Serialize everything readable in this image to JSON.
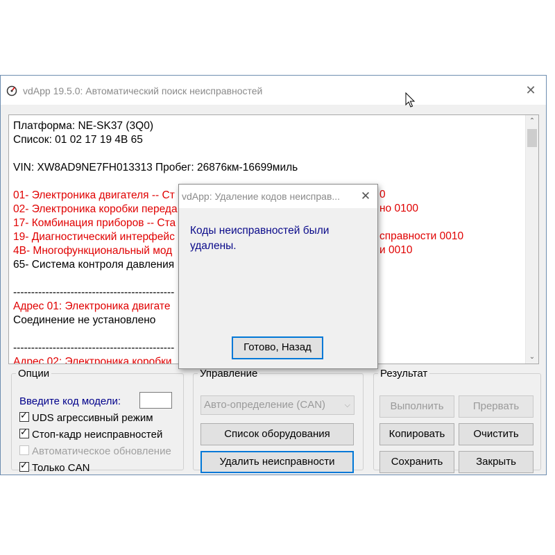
{
  "window": {
    "title": "vdApp 19.5.0:  Автоматический поиск неисправностей",
    "close_glyph": "✕",
    "icon": "vdapp-logo-icon"
  },
  "log": {
    "lines": [
      {
        "text": "Платформа: NE-SK37 (3Q0)",
        "color": "#000000"
      },
      {
        "text": "Список: 01 02 17 19 4B 65",
        "color": "#000000"
      },
      {
        "text": "",
        "color": "#000000"
      },
      {
        "text": "VIN: XW8AD9NE7FH013313   Пробег: 26876км-16699миль",
        "color": "#000000"
      },
      {
        "text": "",
        "color": "#000000"
      },
      {
        "text": "01- Электроника двигателя -- Ст",
        "color": "#e00000"
      },
      {
        "text": "02- Электроника коробки переда",
        "color": "#e00000"
      },
      {
        "text": "17- Комбинация приборов -- Ста",
        "color": "#e00000"
      },
      {
        "text": "19- Диагностический интерфейс",
        "color": "#e00000"
      },
      {
        "text": "4B- Многофункциональный мод",
        "color": "#e00000"
      },
      {
        "text": "65- Система контроля давления",
        "color": "#000000"
      },
      {
        "text": "",
        "color": "#000000"
      },
      {
        "text": "---------------------------------------------",
        "color": "#000000"
      },
      {
        "text": "Адрес 01:  Электроника двигате",
        "color": "#e00000"
      },
      {
        "text": "Соединение не установлено",
        "color": "#000000"
      },
      {
        "text": "",
        "color": "#000000"
      },
      {
        "text": "---------------------------------------------",
        "color": "#000000"
      },
      {
        "text": "Адрес 02:  Электроника коробки",
        "color": "#e00000"
      }
    ],
    "visible_right_fragments": [
      {
        "line": 5,
        "text": "0"
      },
      {
        "line": 6,
        "text": "но 0100"
      },
      {
        "line": 8,
        "text": "справности 0010"
      },
      {
        "line": 9,
        "text": "и 0010"
      }
    ]
  },
  "options": {
    "legend": "Опции",
    "model_label": "Введите код модели:",
    "model_value": "",
    "checkboxes": [
      {
        "label": "UDS агрессивный режим",
        "checked": true,
        "disabled": false
      },
      {
        "label": "Стоп-кадр неисправностей",
        "checked": true,
        "disabled": false
      },
      {
        "label": "Автоматическое обновление",
        "checked": false,
        "disabled": true
      },
      {
        "label": "Только CAN",
        "checked": true,
        "disabled": false
      }
    ]
  },
  "control": {
    "legend": "Управление",
    "dropdown_value": "Авто-определение (CAN)",
    "equipment_button": "Список оборудования",
    "delete_faults_button": "Удалить неисправности"
  },
  "result": {
    "legend": "Результат",
    "execute_button": "Выполнить",
    "abort_button": "Прервать",
    "copy_button": "Копировать",
    "clear_button": "Очистить",
    "save_button": "Сохранить",
    "close_button": "Закрыть"
  },
  "dialog": {
    "title": "vdApp: Удаление кодов неисправ...",
    "close_glyph": "✕",
    "message": "Коды неисправностей были удалены.",
    "ok_button": "Готово, Назад"
  }
}
